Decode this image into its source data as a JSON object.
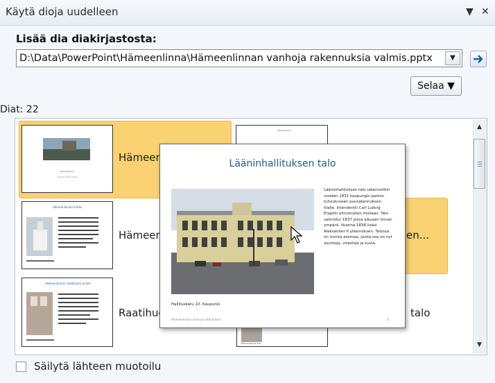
{
  "pane": {
    "title": "Käytä dioja uudelleen",
    "menu_icon": "▼",
    "close_icon": "✕"
  },
  "insert_label": "Lisää dia diakirjastosta:",
  "path_value": "D:\\Data\\PowerPoint\\Hämeenlinna\\Hämeenlinnan vanhoja rakennuksia valmis.pptx",
  "browse_label": "Selaa ▼",
  "slide_count": "Diat: 22",
  "slides": [
    {
      "label": "Hämeenl"
    },
    {
      "label": "Hämeenl"
    },
    {
      "label": "Raatihuo"
    },
    {
      "label": "en..."
    },
    {
      "label": "talo"
    }
  ],
  "preview": {
    "title": "Lääninhallituksen talo",
    "body": "Lääninhallituksen talo rakennettiin vuoden 1831 kaupungin paloon tuhoutuneen puurakennuksen tilalle. Intendentti Carl Ludvig Engelin piirustusten mukaan. Talo valmistui 1837 jossa alkuaan linnan ympärä. Vuonna 1838 lisäsi Aleksanteri II ylikerroksen. Talossa on monta asemaa, joista osa on nyt asuntoja, virastoja ja kuvia.",
    "caption": "Hallituskatu 10, Kaupunki",
    "footer": "Hämeenlinnan vanhoja rakennuksia",
    "page": "6"
  },
  "keep_format_label": "Säilytä lähteen muotoilu",
  "thumb_texts": {
    "t1_title": "Hämeenlinna",
    "t1_sub": "Vanhat rakennukset",
    "t2_title": "Hämeenlinnan kirkko",
    "t3_title": "Hämeenlinnan raatihuone ja talo",
    "t_top": "Hämeenlinna",
    "t_bottom": "Hämeenlinnan talo"
  }
}
